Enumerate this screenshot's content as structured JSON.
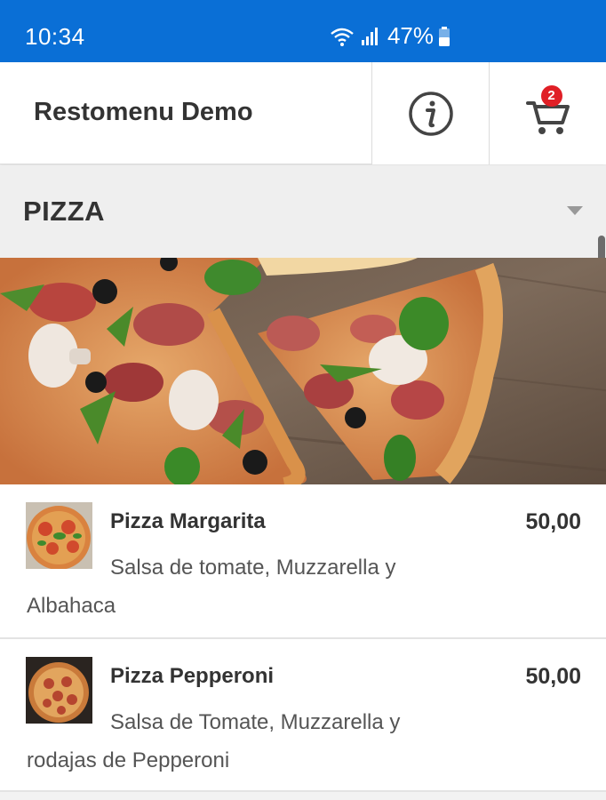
{
  "status_bar": {
    "time": "10:34",
    "battery_percent": "47%",
    "icons": [
      "wifi-icon",
      "signal-icon",
      "battery-icon"
    ]
  },
  "app_bar": {
    "title": "Restomenu Demo",
    "info_icon": "info-icon",
    "cart_icon": "cart-icon",
    "cart_count": "2"
  },
  "section": {
    "title": "PIZZA",
    "toggle_icon": "caret-down-icon"
  },
  "hero": {
    "image": "pizza-hero-photo"
  },
  "items": [
    {
      "name": "Pizza Margarita",
      "price": "50,00",
      "description": "Salsa de tomate, Muzzarella y Albahaca",
      "image": "margarita-thumbnail"
    },
    {
      "name": "Pizza Pepperoni",
      "price": "50,00",
      "description": "Salsa de Tomate, Muzzarella y rodajas de Pepperoni",
      "image": "pepperoni-thumbnail"
    }
  ],
  "colors": {
    "status_bar": "#0a6fd6",
    "badge": "#e01f26",
    "text_dark": "#333333"
  }
}
